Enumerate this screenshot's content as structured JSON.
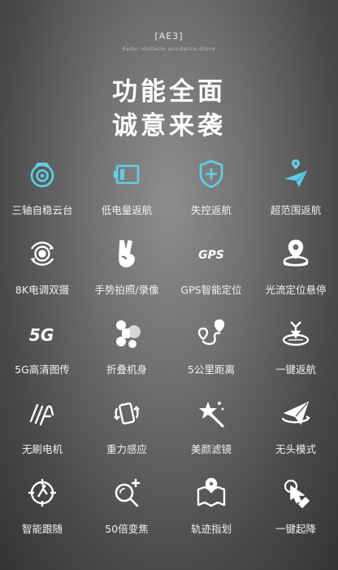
{
  "header": {
    "model": "[AE3]",
    "subtitle": "Radar obstacle avoidance drone"
  },
  "title": {
    "line1": "功能全面",
    "line2": "诚意来袭"
  },
  "colors": {
    "accent": "#5fd0e8",
    "text": "#ffffff"
  },
  "features": [
    {
      "label": "三轴自稳云台",
      "icon": "gimbal-camera-icon"
    },
    {
      "label": "低电量返航",
      "icon": "low-battery-icon"
    },
    {
      "label": "失控返航",
      "icon": "shield-plus-icon"
    },
    {
      "label": "超范围返航",
      "icon": "paper-plane-location-icon"
    },
    {
      "label": "8K电调双摄",
      "icon": "dual-camera-icon"
    },
    {
      "label": "手势拍照/录像",
      "icon": "gesture-hand-icon"
    },
    {
      "label": "GPS智能定位",
      "icon": "gps-icon"
    },
    {
      "label": "光流定位悬停",
      "icon": "optical-flow-icon"
    },
    {
      "label": "5G高清图传",
      "icon": "5g-icon"
    },
    {
      "label": "折叠机身",
      "icon": "folding-drone-icon"
    },
    {
      "label": "5公里距离",
      "icon": "route-distance-icon"
    },
    {
      "label": "一键返航",
      "icon": "one-key-return-icon"
    },
    {
      "label": "无刷电机",
      "icon": "brushless-motor-icon"
    },
    {
      "label": "重力感应",
      "icon": "gravity-sensor-icon"
    },
    {
      "label": "美颜滤镜",
      "icon": "beauty-filter-icon"
    },
    {
      "label": "无头模式",
      "icon": "headless-mode-icon"
    },
    {
      "label": "智能跟随",
      "icon": "smart-follow-icon"
    },
    {
      "label": "50倍变焦",
      "icon": "zoom-icon"
    },
    {
      "label": "轨迹指划",
      "icon": "trajectory-map-icon"
    },
    {
      "label": "一键起降",
      "icon": "one-key-takeoff-icon"
    }
  ]
}
